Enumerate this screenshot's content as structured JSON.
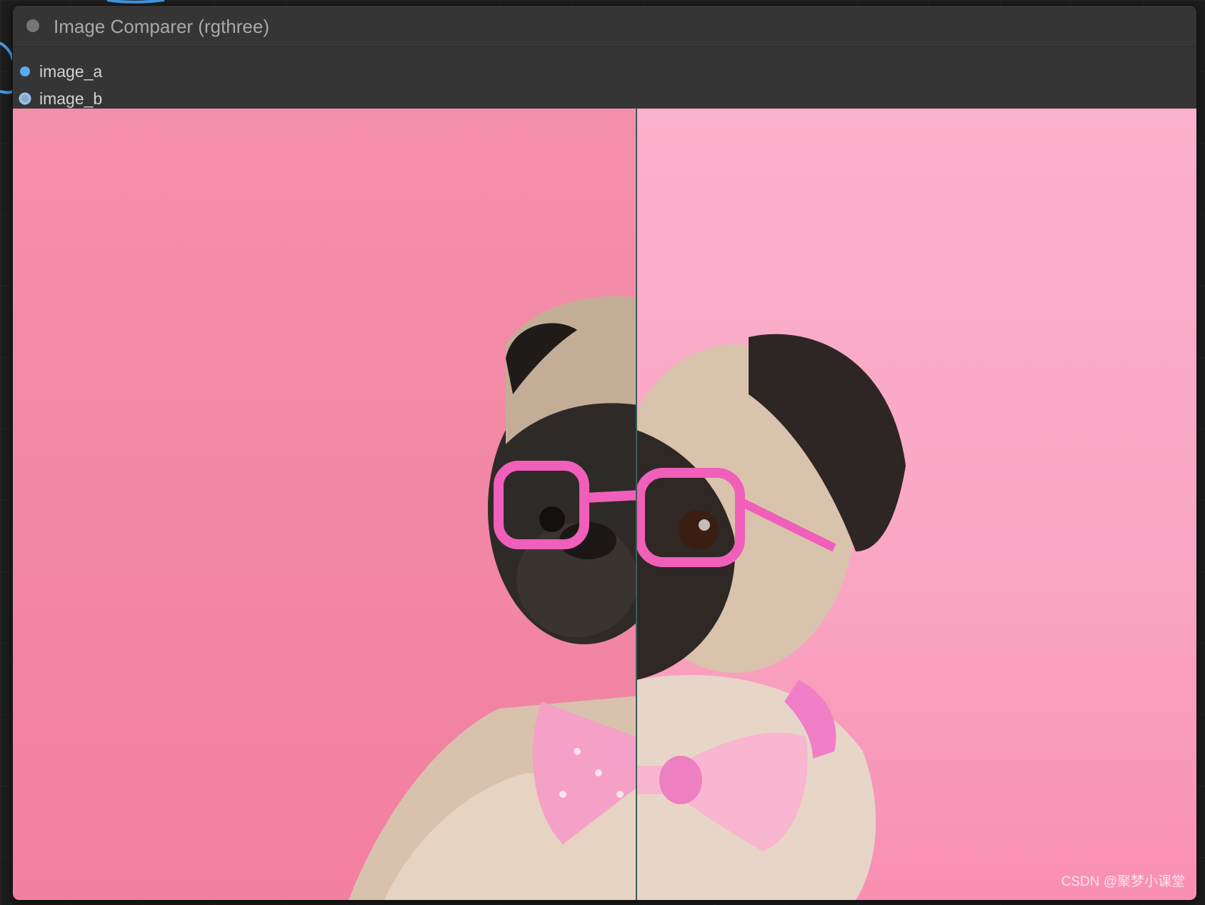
{
  "node": {
    "title": "Image Comparer (rgthree)",
    "inputs": [
      {
        "name": "image_a",
        "color": "#5aaaf0"
      },
      {
        "name": "image_b",
        "color": "#8aa7c2"
      }
    ]
  },
  "comparer": {
    "split_position_percent": 52.7,
    "image_a_background": "#f287a5",
    "image_b_background": "#f9a6c3",
    "subject_icon": "pug-with-pink-glasses-and-bow-tie"
  },
  "watermark": "CSDN @聚梦小课堂"
}
